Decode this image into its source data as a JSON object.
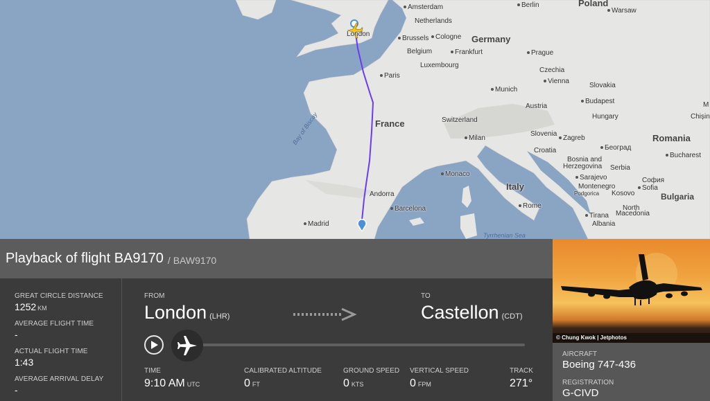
{
  "map": {
    "labels": {
      "amsterdam": "Amsterdam",
      "berlin": "Berlin",
      "poland": "Poland",
      "warsaw": "Warsaw",
      "london": "London",
      "netherlands": "Netherlands",
      "germany": "Germany",
      "brussels": "Brussels",
      "cologne": "Cologne",
      "belgium": "Belgium",
      "frankfurt": "Frankfurt",
      "prague": "Prague",
      "luxembourg": "Luxembourg",
      "czechia": "Czechia",
      "paris": "Paris",
      "vienna": "Vienna",
      "munich": "Munich",
      "slovakia": "Slovakia",
      "budapest": "Budapest",
      "austria": "Austria",
      "hungary": "Hungary",
      "chisinau": "Chișin",
      "m": "M",
      "france": "France",
      "switzerland": "Switzerland",
      "bay_of_biscay": "Bay of Biscay",
      "milan": "Milan",
      "slovenia": "Slovenia",
      "zagreb": "Zagreb",
      "beograd": "Београд",
      "romania": "Romania",
      "croatia": "Croatia",
      "bosnia": "Bosnia and",
      "herzegovina": "Herzegovina",
      "serbia": "Serbia",
      "bucharest": "Bucharest",
      "monaco": "Monaco",
      "sarajevo": "Sarajevo",
      "sofia_cyr": "София",
      "andorra": "Andorra",
      "italy": "Italy",
      "montenegro": "Montenegro",
      "kosovo": "Kosovo",
      "sofia": "Sofia",
      "podgorica": "Podgorica",
      "bulgaria": "Bulgaria",
      "barcelona": "Barcelona",
      "rome": "Rome",
      "north": "North",
      "macedonia": "Macedonia",
      "tirana": "Tirana",
      "madrid": "Madrid",
      "albania": "Albania",
      "tyrrhenian": "Tyrrhenian Sea"
    }
  },
  "header": {
    "title": "Playback of flight BA9170",
    "callsign": "/ BAW9170"
  },
  "stats": [
    {
      "label": "GREAT CIRCLE DISTANCE",
      "value": "1252",
      "unit": "KM"
    },
    {
      "label": "AVERAGE FLIGHT TIME",
      "value": "-",
      "unit": ""
    },
    {
      "label": "ACTUAL FLIGHT TIME",
      "value": "1:43",
      "unit": ""
    },
    {
      "label": "AVERAGE ARRIVAL DELAY",
      "value": "-",
      "unit": ""
    }
  ],
  "route": {
    "from_label": "FROM",
    "from_city": "London",
    "from_code": "(LHR)",
    "to_label": "TO",
    "to_city": "Castellon",
    "to_code": "(CDT)"
  },
  "playback": {
    "progress": 0.0
  },
  "metrics": {
    "time": {
      "label": "TIME",
      "value": "9:10 AM",
      "unit": "UTC"
    },
    "altitude": {
      "label": "CALIBRATED ALTITUDE",
      "value": "0",
      "unit": "FT"
    },
    "ground_speed": {
      "label": "GROUND SPEED",
      "value": "0",
      "unit": "KTS"
    },
    "vertical_speed": {
      "label": "VERTICAL SPEED",
      "value": "0",
      "unit": "FPM"
    },
    "track": {
      "label": "TRACK",
      "value": "271°",
      "unit": ""
    }
  },
  "aircraft": {
    "photo_credit": "© Chung Kwok | Jetphotos",
    "aircraft_label": "AIRCRAFT",
    "aircraft_value": "Boeing 747-436",
    "registration_label": "REGISTRATION",
    "registration_value": "G-CIVD"
  },
  "colors": {
    "sea": "#8aa4c4",
    "land": "#e6e6e4",
    "track": "#6a3cf0",
    "header": "#5c5c5c",
    "panel": "#3b3b3b"
  }
}
